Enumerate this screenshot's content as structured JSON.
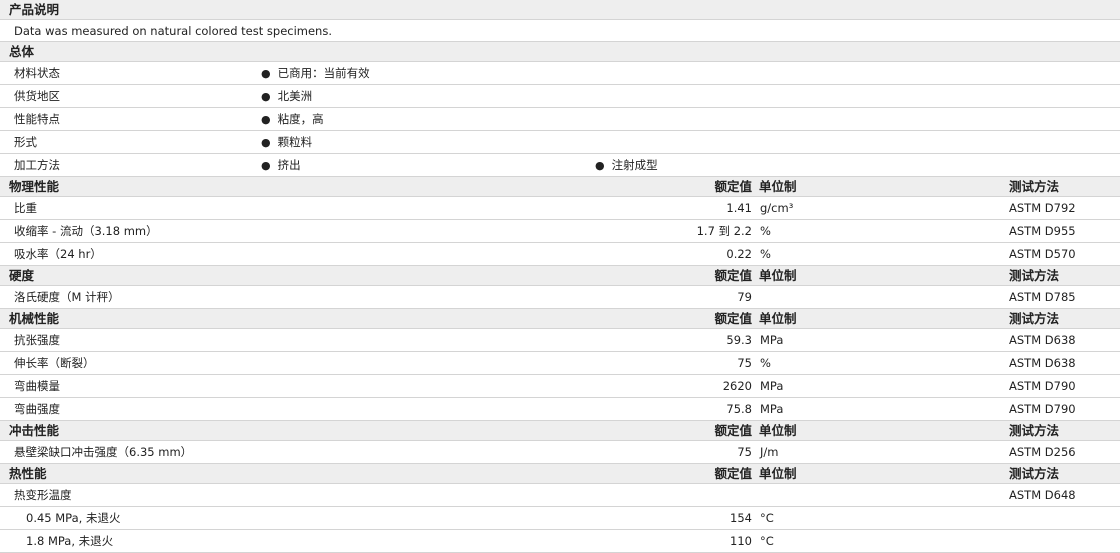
{
  "product": {
    "title": "产品说明",
    "description": "Data was measured on natural colored test specimens."
  },
  "columns": {
    "nominal": "额定值",
    "unit": "单位制",
    "test": "测试方法"
  },
  "general": {
    "title": "总体",
    "rows": [
      {
        "label": "材料状态",
        "values": [
          "已商用：当前有效"
        ]
      },
      {
        "label": "供货地区",
        "values": [
          "北美洲"
        ]
      },
      {
        "label": "性能特点",
        "values": [
          "粘度，高"
        ]
      },
      {
        "label": "形式",
        "values": [
          "颗粒料"
        ]
      },
      {
        "label": "加工方法",
        "values": [
          "挤出",
          "注射成型"
        ]
      }
    ]
  },
  "bullet": "●",
  "physical": {
    "title": "物理性能",
    "rows": [
      {
        "label": "比重",
        "value": "1.41",
        "unit": "g/cm³",
        "test": "ASTM D792"
      },
      {
        "label": "收缩率 - 流动（3.18 mm）",
        "value": "1.7 到  2.2",
        "unit": "%",
        "test": "ASTM D955"
      },
      {
        "label": "吸水率（24 hr）",
        "value": "0.22",
        "unit": "%",
        "test": "ASTM D570"
      }
    ]
  },
  "hardness": {
    "title": "硬度",
    "rows": [
      {
        "label": "洛氏硬度（M 计秤）",
        "value": "79",
        "unit": "",
        "test": "ASTM D785"
      }
    ]
  },
  "mechanical": {
    "title": "机械性能",
    "rows": [
      {
        "label": "抗张强度",
        "value": "59.3",
        "unit": "MPa",
        "test": "ASTM D638"
      },
      {
        "label": "伸长率（断裂）",
        "value": "75",
        "unit": "%",
        "test": "ASTM D638"
      },
      {
        "label": "弯曲模量",
        "value": "2620",
        "unit": "MPa",
        "test": "ASTM D790"
      },
      {
        "label": "弯曲强度",
        "value": "75.8",
        "unit": "MPa",
        "test": "ASTM D790"
      }
    ]
  },
  "impact": {
    "title": "冲击性能",
    "rows": [
      {
        "label": "悬壁梁缺口冲击强度（6.35 mm）",
        "value": "75",
        "unit": "J/m",
        "test": "ASTM D256"
      }
    ]
  },
  "thermal": {
    "title": "热性能",
    "rows": [
      {
        "label": "热变形温度",
        "value": "",
        "unit": "",
        "test": "ASTM D648"
      },
      {
        "label": "0.45 MPa, 未退火",
        "value": "154",
        "unit": "°C",
        "test": "",
        "sub": true
      },
      {
        "label": "1.8 MPa, 未退火",
        "value": "110",
        "unit": "°C",
        "test": "",
        "sub": true
      }
    ]
  }
}
